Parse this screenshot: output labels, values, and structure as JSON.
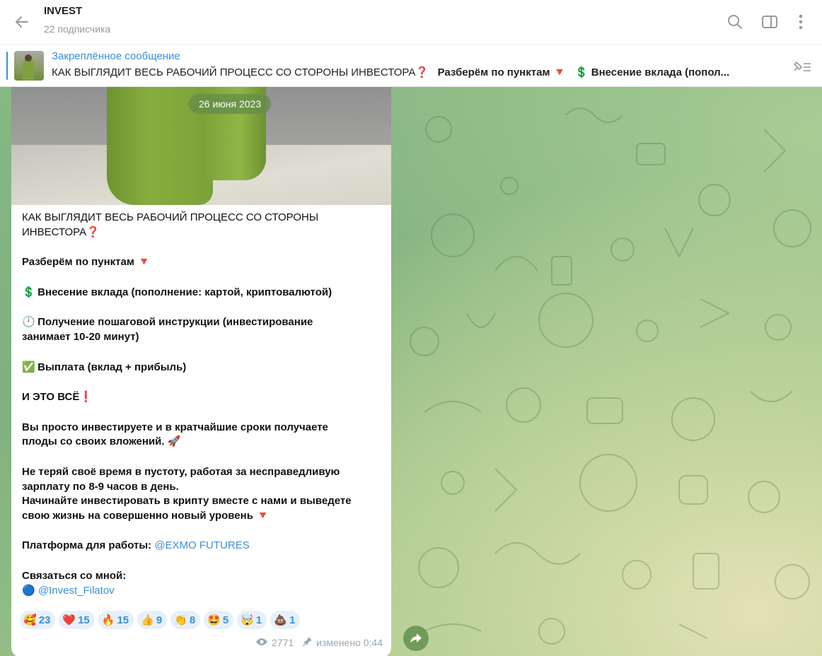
{
  "header": {
    "title": "INVEST",
    "subtitle": "22 подписчика"
  },
  "pinned": {
    "label": "Закреплённое сообщение",
    "text_part1": "КАК ВЫГЛЯДИТ ВЕСЬ РАБОЧИЙ ПРОЦЕСС СО СТОРОНЫ ИНВЕСТОРА",
    "emoji1": "❓",
    "text_part2": "Разберём по пунктам",
    "emoji2": "🔻",
    "emoji3": "💲",
    "text_part3": "Внесение вклада (попол..."
  },
  "message": {
    "date": "26 июня 2023",
    "line1": "КАК ВЫГЛЯДИТ ВЕСЬ РАБОЧИЙ ПРОЦЕСС СО СТОРОНЫ",
    "line2": "ИНВЕСТОРА",
    "q_emoji": "❓",
    "points_title": "Разберём по пунктам",
    "down_emoji": "🔻",
    "dollar_emoji": "💲",
    "point1": "Внесение вклада (пополнение: картой, криптовалютой)",
    "clock_emoji": "🕛",
    "point2a": "Получение пошаговой инструкции (инвестирование",
    "point2b": "занимает 10-20 минут)",
    "check_emoji": "✅",
    "point3": "Выплата (вклад + прибыль)",
    "all": "И ЭТО ВСЁ",
    "excl_emoji": "❗",
    "p1a": "Вы просто инвестируете и в кратчайшие сроки получаете",
    "p1b": "плоды со своих вложений.",
    "rocket_emoji": "🚀",
    "p2a": "Не теряй своё время в пустоту, работая за несправедливую",
    "p2b": "зарплату по 8-9 часов в день.",
    "p2c": "Начинайте инвестировать в крипту вместе с нами и выведете",
    "p2d": "свою жизнь на совершенно новый уровень",
    "platform_label": "Платформа для работы:",
    "platform_link": "@EXMO FUTURES",
    "contact_label": "Связаться со мной:",
    "blue_emoji": "🔵",
    "contact_link": "@Invest_Filatov",
    "views": "2771",
    "edited": "изменено 0:44"
  },
  "reactions": [
    {
      "emoji": "🥰",
      "count": "23"
    },
    {
      "emoji": "❤️",
      "count": "15"
    },
    {
      "emoji": "🔥",
      "count": "15"
    },
    {
      "emoji": "👍",
      "count": "9"
    },
    {
      "emoji": "👏",
      "count": "8"
    },
    {
      "emoji": "🤩",
      "count": "5"
    },
    {
      "emoji": "🤯",
      "count": "1"
    },
    {
      "emoji": "💩",
      "count": "1"
    }
  ],
  "colors": {
    "accent": "#3a8fd6",
    "chat_bg": "#86b884",
    "reaction_bg": "#e6f0fa"
  },
  "icons": [
    "back-arrow-icon",
    "search-icon",
    "sidebar-toggle-icon",
    "more-vertical-icon",
    "unpin-icon",
    "eye-icon",
    "pin-icon",
    "share-icon"
  ]
}
